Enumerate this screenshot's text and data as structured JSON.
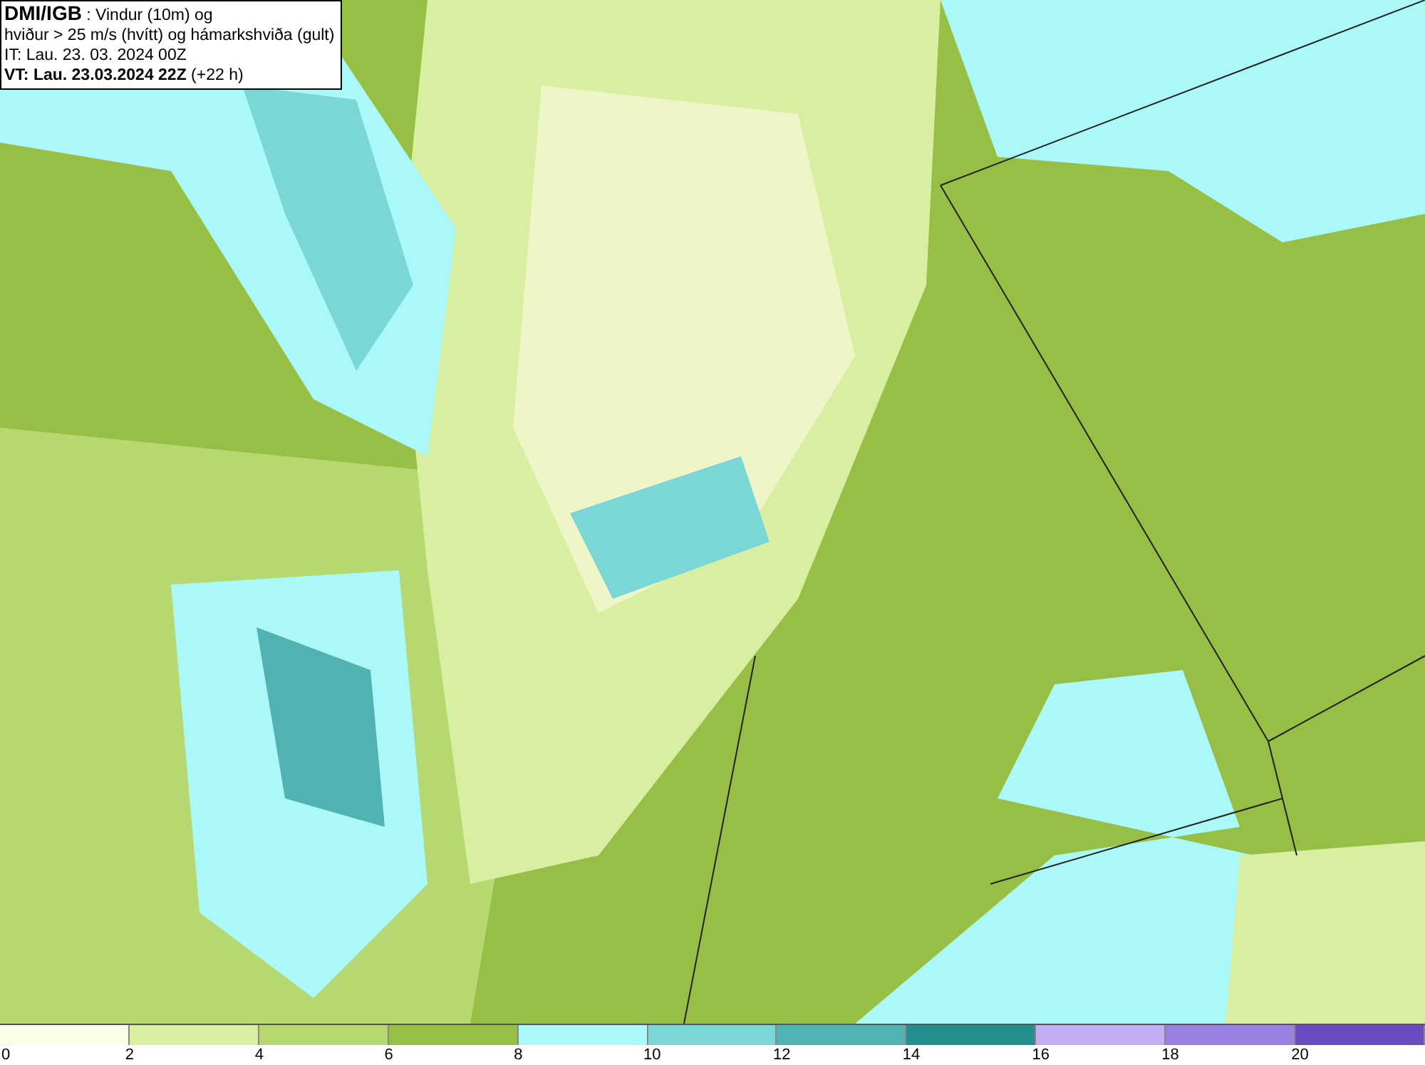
{
  "info_box": {
    "lines": [
      "**DMI/IGB** : Vindur (10m) og",
      "hviður > 25 m/s (hvítt) og hámarkshviða (gult)",
      "IT: Lau. 23. 03. 2024 00Z",
      "**VT: Lau. 23.03.2024 22Z** (+22 h)"
    ]
  },
  "color_scale": {
    "bins": [
      {
        "label": "0",
        "color": "#fbfde6"
      },
      {
        "label": "2",
        "color": "#d8eea0"
      },
      {
        "label": "4",
        "color": "#b5d870"
      },
      {
        "label": "6",
        "color": "#98bf45"
      },
      {
        "label": "8",
        "color": "#aaf8f8"
      },
      {
        "label": "10",
        "color": "#7bd6d6"
      },
      {
        "label": "12",
        "color": "#52b2b2"
      },
      {
        "label": "14",
        "color": "#258f8f"
      },
      {
        "label": "16",
        "color": "#c2aef5"
      },
      {
        "label": "18",
        "color": "#9a80e0"
      },
      {
        "label": "20",
        "color": "#6a4cc0"
      }
    ]
  }
}
